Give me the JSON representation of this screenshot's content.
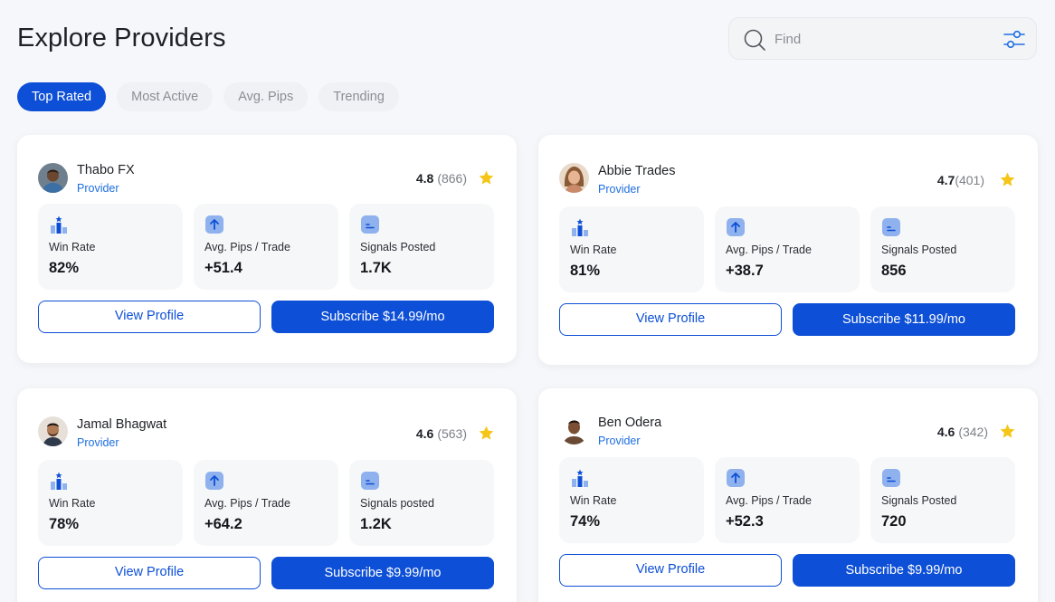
{
  "page": {
    "title": "Explore Providers"
  },
  "search": {
    "placeholder": "Find",
    "value": ""
  },
  "tabs": [
    {
      "label": "Top Rated",
      "active": true
    },
    {
      "label": "Most Active",
      "active": false
    },
    {
      "label": "Avg. Pips",
      "active": false
    },
    {
      "label": "Trending",
      "active": false
    }
  ],
  "providers": [
    {
      "name": "Thabo FX",
      "role": "Provider",
      "rating": "4.8",
      "reviews": "(866)",
      "stats": [
        {
          "label": "Win Rate",
          "value": "82%"
        },
        {
          "label": "Avg. Pips / Trade",
          "value": "+51.4"
        },
        {
          "label": "Signals Posted",
          "value": "1.7K"
        }
      ],
      "view_label": "View Profile",
      "subscribe_label": "Subscribe $14.99/mo"
    },
    {
      "name": "Abbie Trades",
      "role": "Provider",
      "rating": "4.7",
      "reviews": "(401)",
      "stats": [
        {
          "label": "Win Rate",
          "value": "81%"
        },
        {
          "label": "Avg. Pips / Trade",
          "value": "+38.7"
        },
        {
          "label": "Signals Posted",
          "value": "856"
        }
      ],
      "view_label": "View Profile",
      "subscribe_label": "Subscribe $11.99/mo"
    },
    {
      "name": "Jamal Bhagwat",
      "role": "Provider",
      "rating": "4.6",
      "reviews": "(563)",
      "stats": [
        {
          "label": "Win Rate",
          "value": "78%"
        },
        {
          "label": "Avg. Pips / Trade",
          "value": "+64.2"
        },
        {
          "label": "Signals posted",
          "value": "1.2K"
        }
      ],
      "view_label": "View Profile",
      "subscribe_label": "Subscribe $9.99/mo"
    },
    {
      "name": "Ben Odera",
      "role": "Provider",
      "rating": "4.6",
      "reviews": "(342)",
      "stats": [
        {
          "label": "Win Rate",
          "value": "74%"
        },
        {
          "label": "Avg. Pips / Trade",
          "value": "+52.3"
        },
        {
          "label": "Signals Posted",
          "value": "720"
        }
      ],
      "view_label": "View Profile",
      "subscribe_label": "Subscribe $9.99/mo"
    }
  ],
  "icons": {
    "search": "search-icon",
    "filter": "filter-sliders-icon",
    "star": "star-icon",
    "win_rate": "podium-icon",
    "avg_pips": "arrow-up-icon",
    "signals": "message-square-icon"
  },
  "colors": {
    "primary": "#0d4fd6",
    "accent_text": "#1e6fe0",
    "star": "#f5c518",
    "icon_tint": "#8fb1ee"
  }
}
